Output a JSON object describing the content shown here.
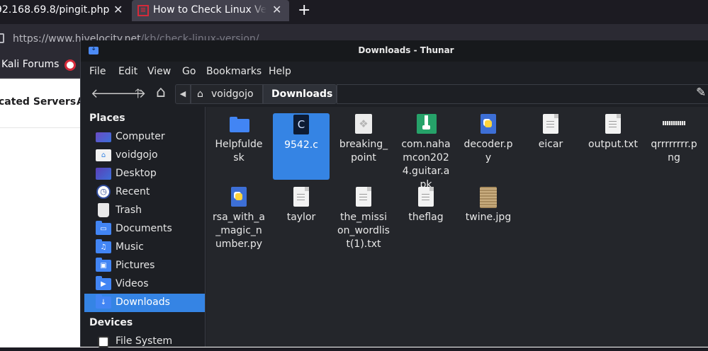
{
  "browser": {
    "tab1_title": "92.168.69.8/pingit.php",
    "tab2_title": "How to Check Linux Version",
    "tab_close": "✕",
    "new_tab": "+",
    "url_main": "https://www.hivelocity.net",
    "url_path": "/kb/check-linux-version/",
    "bookmark1": "Kali Forums",
    "page_text1": "cated Servers",
    "page_text2": "A"
  },
  "window": {
    "title": "Downloads - Thunar"
  },
  "menu": [
    "File",
    "Edit",
    "View",
    "Go",
    "Bookmarks",
    "Help"
  ],
  "toolbar": {
    "back": "🡐",
    "forward": "🡒",
    "up": "🡑",
    "home": "⌂",
    "crumb_prev": "◀",
    "crumb_home": "voidgojo",
    "crumb_current": "Downloads",
    "edit": "✎"
  },
  "sidebar": {
    "places_header": "Places",
    "places": [
      {
        "label": "Computer",
        "icon": "computer-icon"
      },
      {
        "label": "voidgojo",
        "icon": "home-folder-icon"
      },
      {
        "label": "Desktop",
        "icon": "desktop-icon"
      },
      {
        "label": "Recent",
        "icon": "recent-icon"
      },
      {
        "label": "Trash",
        "icon": "trash-icon"
      },
      {
        "label": "Documents",
        "icon": "documents-folder-icon"
      },
      {
        "label": "Music",
        "icon": "music-folder-icon"
      },
      {
        "label": "Pictures",
        "icon": "pictures-folder-icon"
      },
      {
        "label": "Videos",
        "icon": "videos-folder-icon"
      },
      {
        "label": "Downloads",
        "icon": "downloads-folder-icon",
        "selected": true
      }
    ],
    "devices_header": "Devices",
    "devices": [
      {
        "label": "File System",
        "icon": "filesystem-icon"
      }
    ]
  },
  "files": [
    {
      "name": "Helpfuldesk",
      "type": "folder"
    },
    {
      "name": "9542.c",
      "type": "c-source",
      "selected": true
    },
    {
      "name": "breaking_point",
      "type": "generic"
    },
    {
      "name": "com.nahamcon2024.guitar.apk",
      "type": "apk"
    },
    {
      "name": "decoder.py",
      "type": "python"
    },
    {
      "name": "eicar",
      "type": "text"
    },
    {
      "name": "output.txt",
      "type": "text"
    },
    {
      "name": "qrrrrrrrr.png",
      "type": "image-qr"
    },
    {
      "name": "rsa_with_a_magic_number.py",
      "type": "python"
    },
    {
      "name": "taylor",
      "type": "text"
    },
    {
      "name": "the_mission_wordlist(1).txt",
      "type": "text"
    },
    {
      "name": "theflag",
      "type": "text"
    },
    {
      "name": "twine.jpg",
      "type": "image-photo"
    }
  ],
  "colors": {
    "accent": "#3584e4",
    "folder": "#4285f4"
  }
}
